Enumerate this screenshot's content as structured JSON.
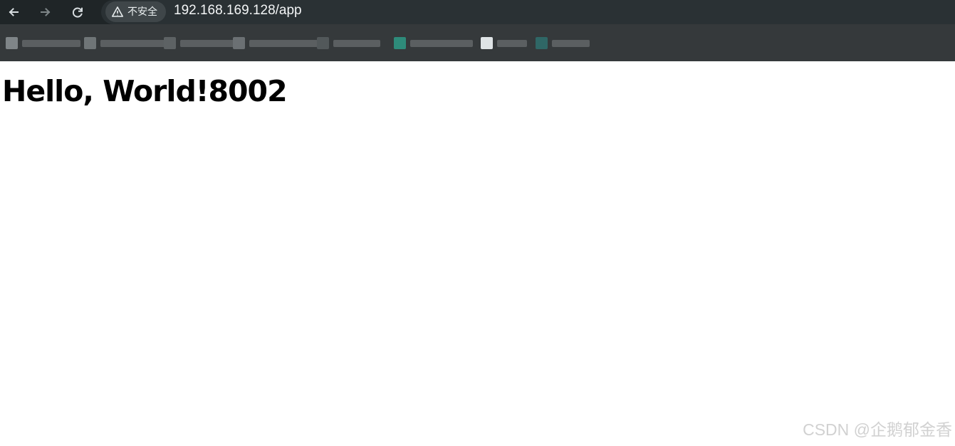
{
  "browser": {
    "security_text": "不安全",
    "url": "192.168.169.128/app",
    "icons": {
      "back": "arrow-left-icon",
      "forward": "arrow-right-icon",
      "reload": "reload-icon",
      "security": "warning-triangle-icon"
    },
    "colors": {
      "toolbar": "#1f2527",
      "bookmarks_bar": "#35393b",
      "omnibox": "#2a3134",
      "chip": "#3f4649"
    }
  },
  "page": {
    "heading": "Hello, World!8002"
  },
  "watermark": {
    "text": "CSDN @企鹅郁金香"
  }
}
